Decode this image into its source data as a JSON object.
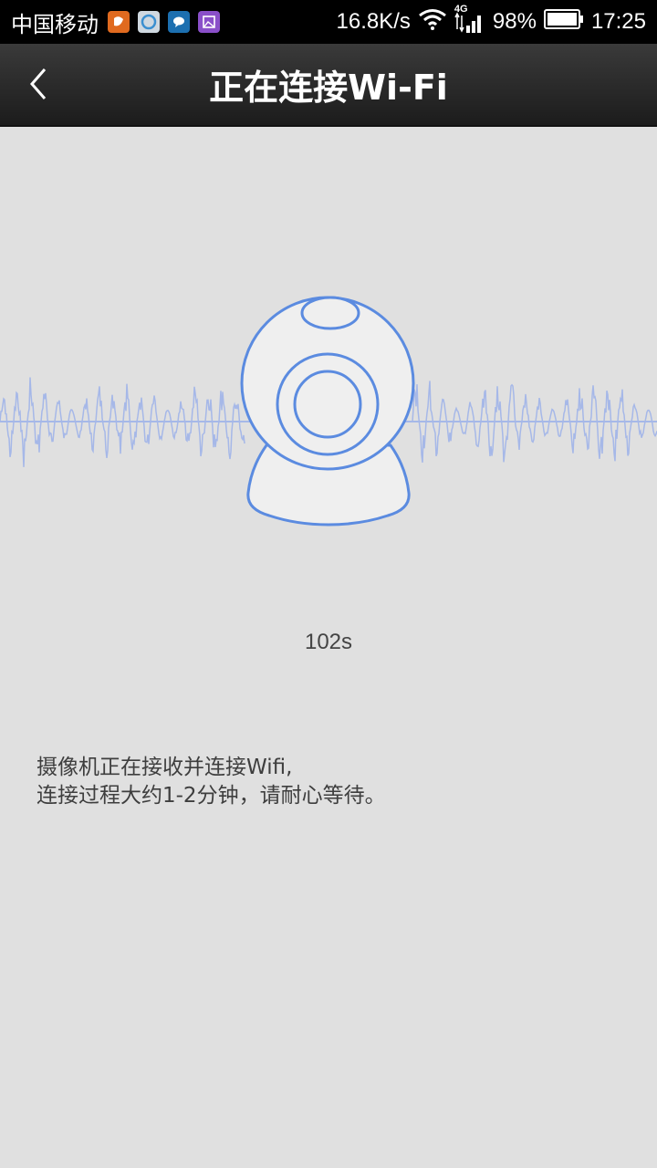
{
  "status_bar": {
    "carrier": "中国移动",
    "network_speed": "16.8K/s",
    "network_type": "4G",
    "battery": "98%",
    "time": "17:25",
    "notification_icons": [
      "uc-browser-icon",
      "browser-icon",
      "chat-icon",
      "gallery-icon"
    ]
  },
  "header": {
    "title": "正在连接Wi-Fi",
    "back_icon": "chevron-left-icon"
  },
  "main": {
    "illustration_icon": "webcam-icon",
    "timer": "102s",
    "message_lines": [
      "摄像机正在接收并连接Wifi,",
      "连接过程大约1-2分钟，请耐心等待。"
    ]
  },
  "colors": {
    "accent": "#5b8be0",
    "wave": "#a6b8e8",
    "background": "#e0e0e0",
    "header": "#2a2a2a"
  }
}
